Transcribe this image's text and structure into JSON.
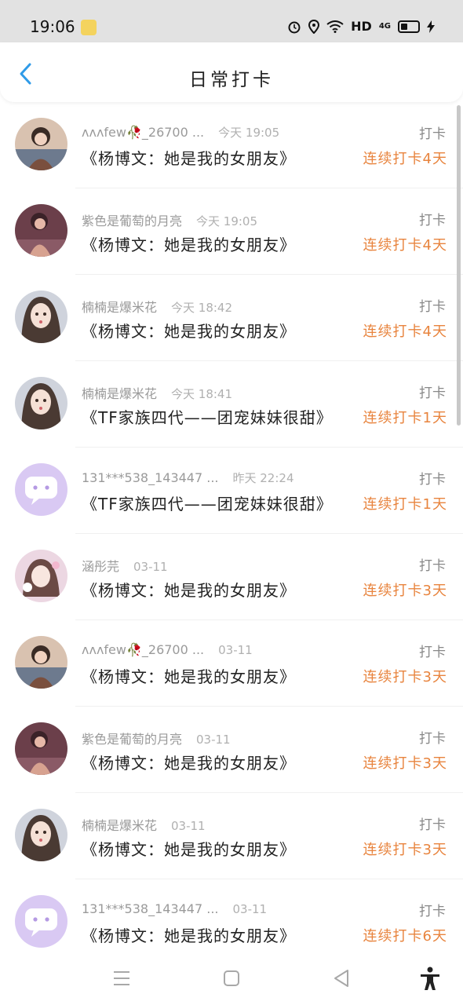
{
  "status_bar": {
    "time": "19:06",
    "network": "HD",
    "cell": "4G"
  },
  "header": {
    "title": "日常打卡"
  },
  "records": [
    {
      "user": "ᴧᴧᴧfew🥀_26700 ...",
      "time": "今天 19:05",
      "content": "《杨博文：她是我的女朋友》",
      "tag": "打卡",
      "streak": "连续打卡4天"
    },
    {
      "user": "紫色是葡萄的月亮",
      "time": "今天 19:05",
      "content": "《杨博文：她是我的女朋友》",
      "tag": "打卡",
      "streak": "连续打卡4天"
    },
    {
      "user": "楠楠是爆米花",
      "time": "今天 18:42",
      "content": "《杨博文：她是我的女朋友》",
      "tag": "打卡",
      "streak": "连续打卡4天"
    },
    {
      "user": "楠楠是爆米花",
      "time": "今天 18:41",
      "content": "《TF家族四代——团宠妹妹很甜》",
      "tag": "打卡",
      "streak": "连续打卡1天"
    },
    {
      "user": "131***538_143447 ...",
      "time": "昨天 22:24",
      "content": "《TF家族四代——团宠妹妹很甜》",
      "tag": "打卡",
      "streak": "连续打卡1天"
    },
    {
      "user": "涵彤芫",
      "time": "03-11",
      "content": "《杨博文：她是我的女朋友》",
      "tag": "打卡",
      "streak": "连续打卡3天"
    },
    {
      "user": "ᴧᴧᴧfew🥀_26700 ...",
      "time": "03-11",
      "content": "《杨博文：她是我的女朋友》",
      "tag": "打卡",
      "streak": "连续打卡3天"
    },
    {
      "user": "紫色是葡萄的月亮",
      "time": "03-11",
      "content": "《杨博文：她是我的女朋友》",
      "tag": "打卡",
      "streak": "连续打卡3天"
    },
    {
      "user": "楠楠是爆米花",
      "time": "03-11",
      "content": "《杨博文：她是我的女朋友》",
      "tag": "打卡",
      "streak": "连续打卡3天"
    },
    {
      "user": "131***538_143447 ...",
      "time": "03-11",
      "content": "《杨博文：她是我的女朋友》",
      "tag": "打卡",
      "streak": "连续打卡6天"
    }
  ],
  "colors": {
    "accent": "#2f9be8",
    "streak": "#e8843e",
    "bubble_avatar": "#d9c9f3"
  },
  "icons": [
    "back-icon",
    "menu-icon",
    "home-icon",
    "nav-back-icon",
    "accessibility-icon"
  ]
}
